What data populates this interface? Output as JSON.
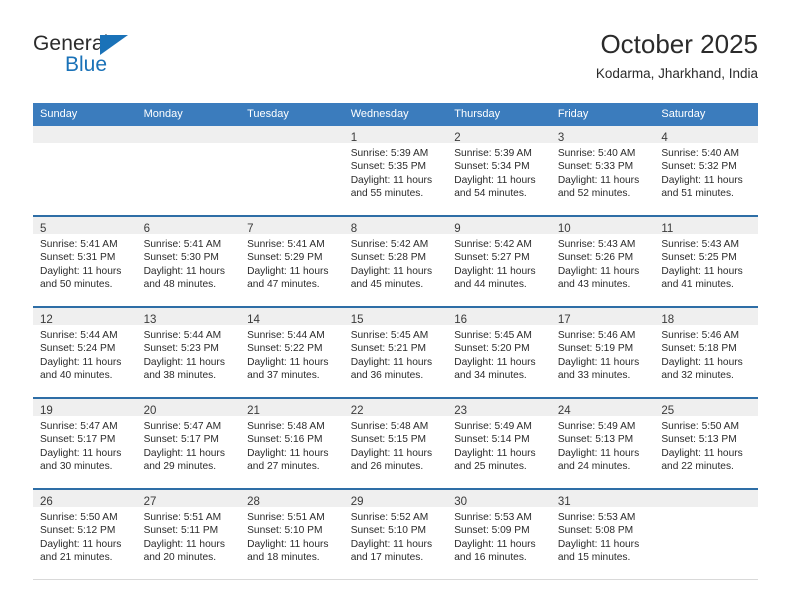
{
  "brand": {
    "word_one": "General",
    "word_two": "Blue",
    "accent_color": "#1a72b8"
  },
  "header": {
    "title": "October 2025",
    "subtitle": "Kodarma, Jharkhand, India"
  },
  "theme": {
    "header_blue": "#3b7cbd",
    "row_divider_blue": "#2e6ea6",
    "daynum_band_gray": "#efefef",
    "text_color": "#2b2b2b"
  },
  "calendar": {
    "weekday_headers": [
      "Sunday",
      "Monday",
      "Tuesday",
      "Wednesday",
      "Thursday",
      "Friday",
      "Saturday"
    ],
    "labels": {
      "sunrise": "Sunrise:",
      "sunset": "Sunset:",
      "daylight": "Daylight:"
    },
    "weeks": [
      [
        {
          "day": "",
          "empty": true
        },
        {
          "day": "",
          "empty": true
        },
        {
          "day": "",
          "empty": true
        },
        {
          "day": "1",
          "sunrise": "Sunrise: 5:39 AM",
          "sunset": "Sunset: 5:35 PM",
          "daylight_1": "Daylight: 11 hours",
          "daylight_2": "and 55 minutes."
        },
        {
          "day": "2",
          "sunrise": "Sunrise: 5:39 AM",
          "sunset": "Sunset: 5:34 PM",
          "daylight_1": "Daylight: 11 hours",
          "daylight_2": "and 54 minutes."
        },
        {
          "day": "3",
          "sunrise": "Sunrise: 5:40 AM",
          "sunset": "Sunset: 5:33 PM",
          "daylight_1": "Daylight: 11 hours",
          "daylight_2": "and 52 minutes."
        },
        {
          "day": "4",
          "sunrise": "Sunrise: 5:40 AM",
          "sunset": "Sunset: 5:32 PM",
          "daylight_1": "Daylight: 11 hours",
          "daylight_2": "and 51 minutes."
        }
      ],
      [
        {
          "day": "5",
          "sunrise": "Sunrise: 5:41 AM",
          "sunset": "Sunset: 5:31 PM",
          "daylight_1": "Daylight: 11 hours",
          "daylight_2": "and 50 minutes."
        },
        {
          "day": "6",
          "sunrise": "Sunrise: 5:41 AM",
          "sunset": "Sunset: 5:30 PM",
          "daylight_1": "Daylight: 11 hours",
          "daylight_2": "and 48 minutes."
        },
        {
          "day": "7",
          "sunrise": "Sunrise: 5:41 AM",
          "sunset": "Sunset: 5:29 PM",
          "daylight_1": "Daylight: 11 hours",
          "daylight_2": "and 47 minutes."
        },
        {
          "day": "8",
          "sunrise": "Sunrise: 5:42 AM",
          "sunset": "Sunset: 5:28 PM",
          "daylight_1": "Daylight: 11 hours",
          "daylight_2": "and 45 minutes."
        },
        {
          "day": "9",
          "sunrise": "Sunrise: 5:42 AM",
          "sunset": "Sunset: 5:27 PM",
          "daylight_1": "Daylight: 11 hours",
          "daylight_2": "and 44 minutes."
        },
        {
          "day": "10",
          "sunrise": "Sunrise: 5:43 AM",
          "sunset": "Sunset: 5:26 PM",
          "daylight_1": "Daylight: 11 hours",
          "daylight_2": "and 43 minutes."
        },
        {
          "day": "11",
          "sunrise": "Sunrise: 5:43 AM",
          "sunset": "Sunset: 5:25 PM",
          "daylight_1": "Daylight: 11 hours",
          "daylight_2": "and 41 minutes."
        }
      ],
      [
        {
          "day": "12",
          "sunrise": "Sunrise: 5:44 AM",
          "sunset": "Sunset: 5:24 PM",
          "daylight_1": "Daylight: 11 hours",
          "daylight_2": "and 40 minutes."
        },
        {
          "day": "13",
          "sunrise": "Sunrise: 5:44 AM",
          "sunset": "Sunset: 5:23 PM",
          "daylight_1": "Daylight: 11 hours",
          "daylight_2": "and 38 minutes."
        },
        {
          "day": "14",
          "sunrise": "Sunrise: 5:44 AM",
          "sunset": "Sunset: 5:22 PM",
          "daylight_1": "Daylight: 11 hours",
          "daylight_2": "and 37 minutes."
        },
        {
          "day": "15",
          "sunrise": "Sunrise: 5:45 AM",
          "sunset": "Sunset: 5:21 PM",
          "daylight_1": "Daylight: 11 hours",
          "daylight_2": "and 36 minutes."
        },
        {
          "day": "16",
          "sunrise": "Sunrise: 5:45 AM",
          "sunset": "Sunset: 5:20 PM",
          "daylight_1": "Daylight: 11 hours",
          "daylight_2": "and 34 minutes."
        },
        {
          "day": "17",
          "sunrise": "Sunrise: 5:46 AM",
          "sunset": "Sunset: 5:19 PM",
          "daylight_1": "Daylight: 11 hours",
          "daylight_2": "and 33 minutes."
        },
        {
          "day": "18",
          "sunrise": "Sunrise: 5:46 AM",
          "sunset": "Sunset: 5:18 PM",
          "daylight_1": "Daylight: 11 hours",
          "daylight_2": "and 32 minutes."
        }
      ],
      [
        {
          "day": "19",
          "sunrise": "Sunrise: 5:47 AM",
          "sunset": "Sunset: 5:17 PM",
          "daylight_1": "Daylight: 11 hours",
          "daylight_2": "and 30 minutes."
        },
        {
          "day": "20",
          "sunrise": "Sunrise: 5:47 AM",
          "sunset": "Sunset: 5:17 PM",
          "daylight_1": "Daylight: 11 hours",
          "daylight_2": "and 29 minutes."
        },
        {
          "day": "21",
          "sunrise": "Sunrise: 5:48 AM",
          "sunset": "Sunset: 5:16 PM",
          "daylight_1": "Daylight: 11 hours",
          "daylight_2": "and 27 minutes."
        },
        {
          "day": "22",
          "sunrise": "Sunrise: 5:48 AM",
          "sunset": "Sunset: 5:15 PM",
          "daylight_1": "Daylight: 11 hours",
          "daylight_2": "and 26 minutes."
        },
        {
          "day": "23",
          "sunrise": "Sunrise: 5:49 AM",
          "sunset": "Sunset: 5:14 PM",
          "daylight_1": "Daylight: 11 hours",
          "daylight_2": "and 25 minutes."
        },
        {
          "day": "24",
          "sunrise": "Sunrise: 5:49 AM",
          "sunset": "Sunset: 5:13 PM",
          "daylight_1": "Daylight: 11 hours",
          "daylight_2": "and 24 minutes."
        },
        {
          "day": "25",
          "sunrise": "Sunrise: 5:50 AM",
          "sunset": "Sunset: 5:13 PM",
          "daylight_1": "Daylight: 11 hours",
          "daylight_2": "and 22 minutes."
        }
      ],
      [
        {
          "day": "26",
          "sunrise": "Sunrise: 5:50 AM",
          "sunset": "Sunset: 5:12 PM",
          "daylight_1": "Daylight: 11 hours",
          "daylight_2": "and 21 minutes."
        },
        {
          "day": "27",
          "sunrise": "Sunrise: 5:51 AM",
          "sunset": "Sunset: 5:11 PM",
          "daylight_1": "Daylight: 11 hours",
          "daylight_2": "and 20 minutes."
        },
        {
          "day": "28",
          "sunrise": "Sunrise: 5:51 AM",
          "sunset": "Sunset: 5:10 PM",
          "daylight_1": "Daylight: 11 hours",
          "daylight_2": "and 18 minutes."
        },
        {
          "day": "29",
          "sunrise": "Sunrise: 5:52 AM",
          "sunset": "Sunset: 5:10 PM",
          "daylight_1": "Daylight: 11 hours",
          "daylight_2": "and 17 minutes."
        },
        {
          "day": "30",
          "sunrise": "Sunrise: 5:53 AM",
          "sunset": "Sunset: 5:09 PM",
          "daylight_1": "Daylight: 11 hours",
          "daylight_2": "and 16 minutes."
        },
        {
          "day": "31",
          "sunrise": "Sunrise: 5:53 AM",
          "sunset": "Sunset: 5:08 PM",
          "daylight_1": "Daylight: 11 hours",
          "daylight_2": "and 15 minutes."
        },
        {
          "day": "",
          "empty": true
        }
      ]
    ]
  }
}
